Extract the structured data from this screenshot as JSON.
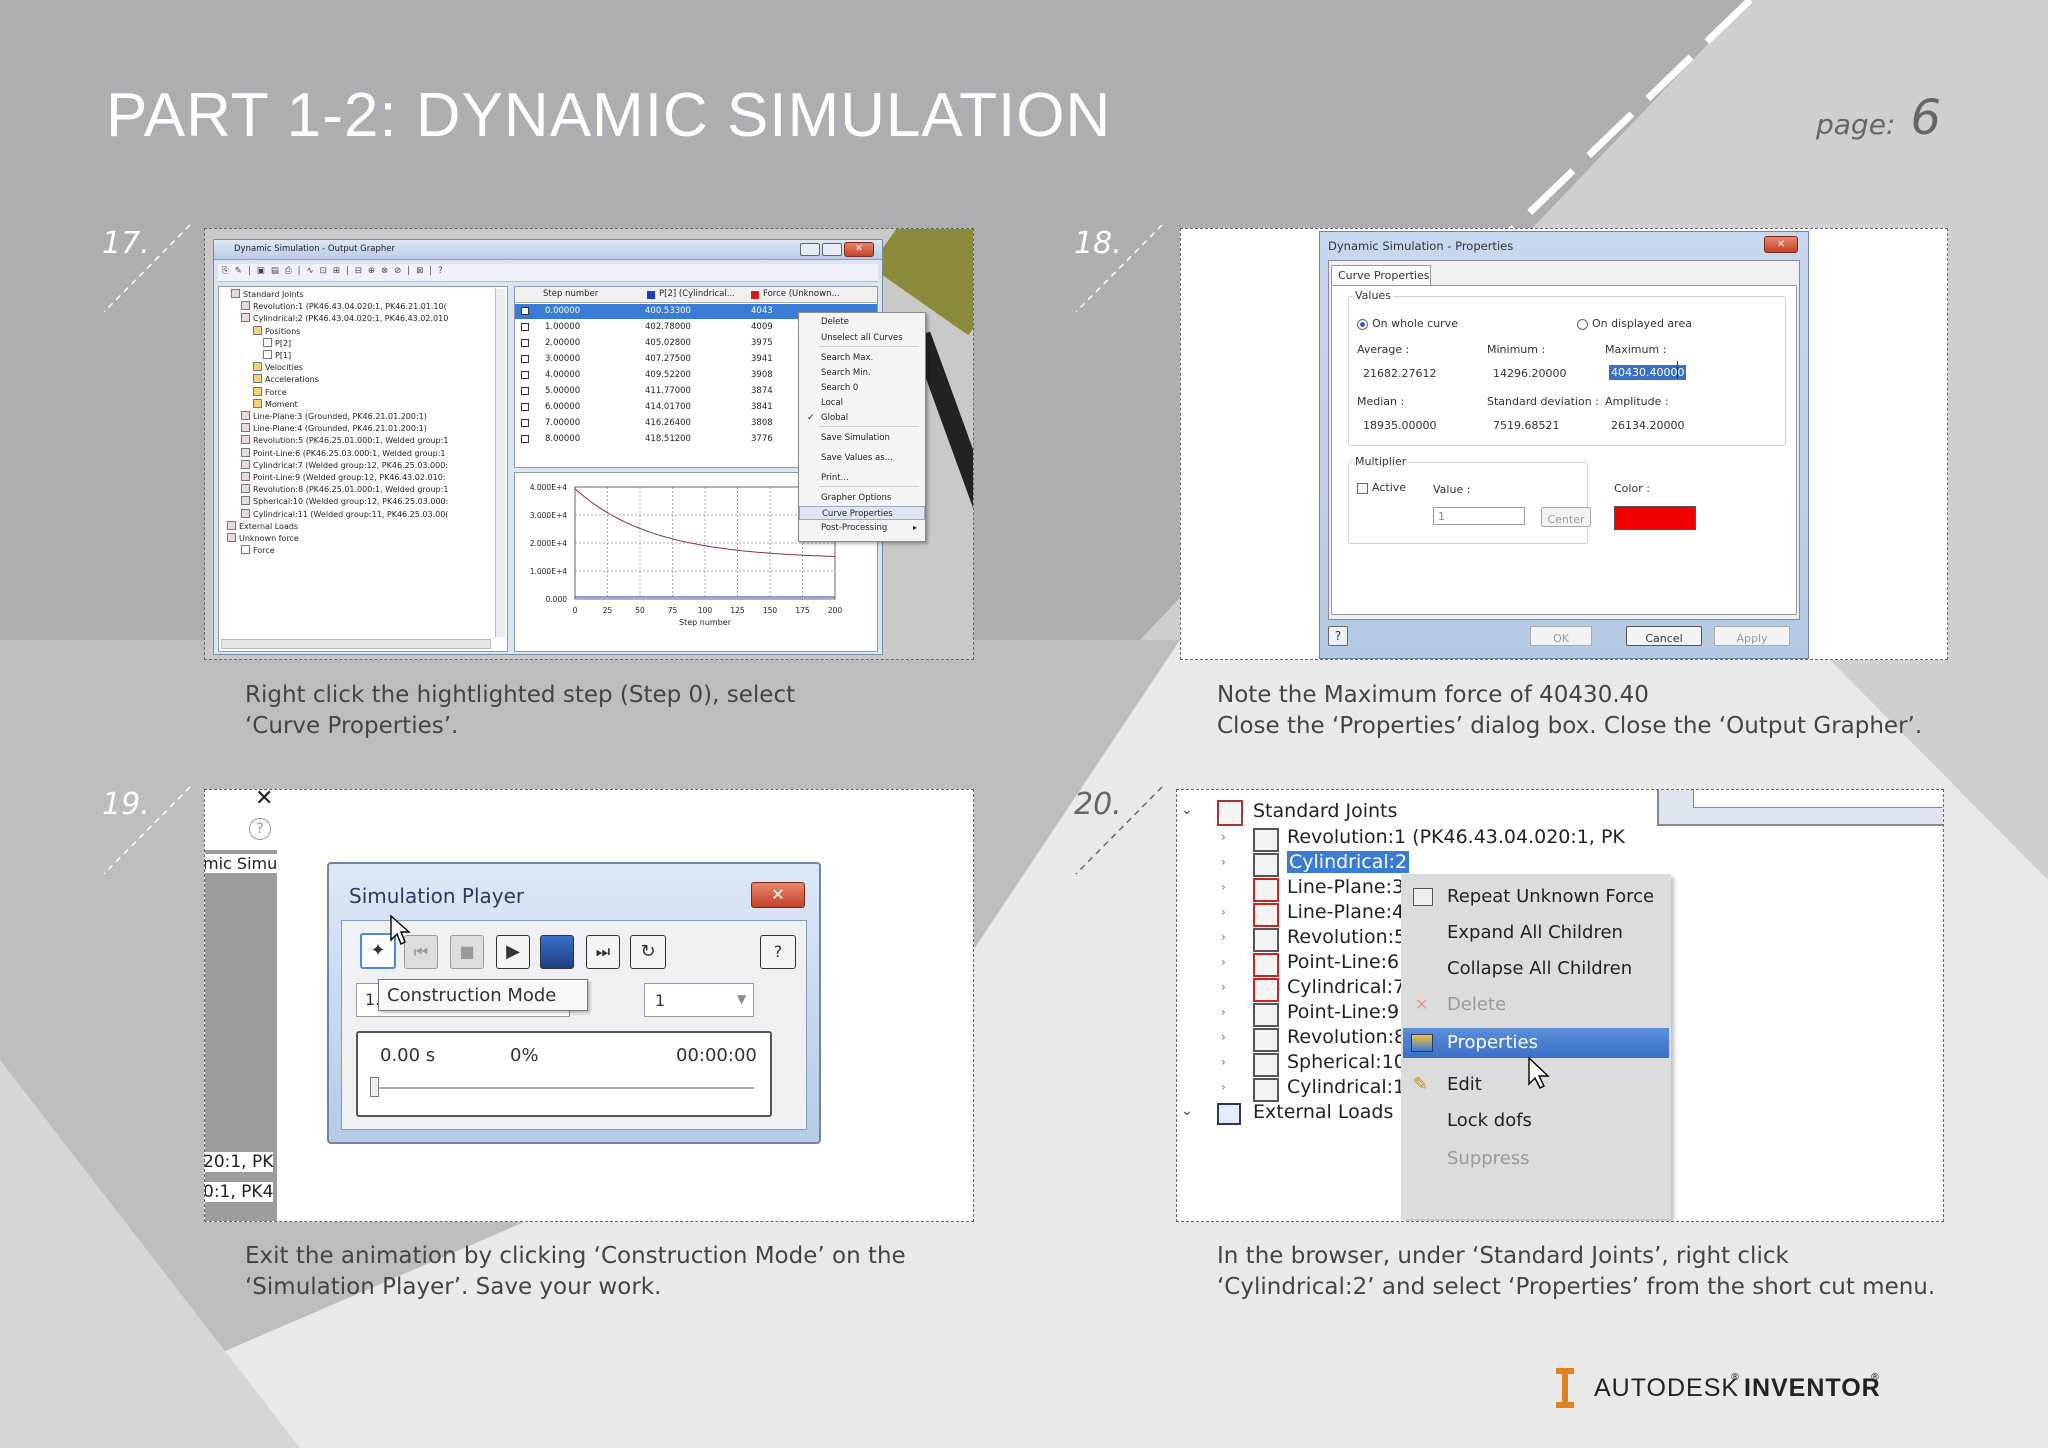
{
  "header": {
    "title": "PART 1-2: DYNAMIC SIMULATION",
    "page_label": "page:",
    "page_number": "6"
  },
  "colors": {
    "title": "#ffffff",
    "bg_gray": "#aeaeb2",
    "accent_red": "#ee0000",
    "highlight": "#3a7bd5",
    "logo_orange": "#e0801e"
  },
  "steps": [
    {
      "number": "17.",
      "caption": [
        "Right click the hightlighted step (Step 0), select",
        "‘Curve Properties’."
      ]
    },
    {
      "number": "18.",
      "caption": [
        "Note the Maximum force of 40430.40",
        "Close the ‘Properties’ dialog box. Close the ‘Output Grapher’."
      ]
    },
    {
      "number": "19.",
      "caption": [
        "Exit the animation by clicking ‘Construction Mode’ on the",
        "‘Simulation Player’. Save your work."
      ]
    },
    {
      "number": "20.",
      "caption": [
        "In the browser, under ‘Standard Joints’, right click",
        "‘Cylindrical:2’ and select ‘Properties’ from the short cut menu."
      ]
    }
  ],
  "grapher": {
    "title": "Dynamic Simulation - Output Grapher",
    "tree": [
      "Standard Joints",
      "Revolution:1 (PK46.43.04.020:1, PK46.21.01.10(",
      "Cylindrical:2 (PK46.43.04.020:1, PK46.43.02.010",
      "Positions",
      "P[2]",
      "P[1]",
      "Velocities",
      "Accelerations",
      "Force",
      "Moment",
      "Line-Plane:3 (Grounded, PK46.21.01.200:1)",
      "Line-Plane:4 (Grounded, PK46.21.01.200:1)",
      "Revolution:5 (PK46.25.01.000:1, Welded group:1",
      "Point-Line:6 (PK46.25.03.000:1, Welded group:1",
      "Cylindrical:7 (Welded group:12, PK46.25.03.000:",
      "Point-Line:9 (Welded group:12, PK46.43.02.010:",
      "Revolution:8 (PK46.25.01.000:1, Welded group:1",
      "Spherical:10 (Welded group:12, PK46.25.03.000:",
      "Cylindrical:11 (Welded group:11, PK46.25.03.00(",
      "External Loads",
      "Unknown force",
      "Force"
    ],
    "columns": [
      "Step number",
      "P[2] (Cylindrical...",
      "Force (Unknown..."
    ],
    "rows": [
      [
        "0.00000",
        "400.53300",
        "4043"
      ],
      [
        "1.00000",
        "402.78000",
        "4009"
      ],
      [
        "2.00000",
        "405.02800",
        "3975"
      ],
      [
        "3.00000",
        "407.27500",
        "3941"
      ],
      [
        "4.00000",
        "409.52200",
        "3908"
      ],
      [
        "5.00000",
        "411.77000",
        "3874"
      ],
      [
        "6.00000",
        "414.01700",
        "3841"
      ],
      [
        "7.00000",
        "416.26400",
        "3808"
      ],
      [
        "8.00000",
        "418.51200",
        "3776"
      ]
    ],
    "context_menu": [
      "Delete",
      "Unselect all Curves",
      "Search Max.",
      "Search Min.",
      "Search 0",
      "Local",
      "Global",
      "Save Simulation",
      "Save Values as...",
      "Print...",
      "Grapher Options",
      "Curve Properties",
      "Post-Processing"
    ],
    "y_ticks": [
      "4.000E+4",
      "3.000E+4",
      "2.000E+4",
      "1.000E+4",
      "0.000"
    ],
    "x_ticks": [
      "0",
      "25",
      "50",
      "75",
      "100",
      "125",
      "150",
      "175",
      "200"
    ],
    "x_label": "Step number"
  },
  "properties": {
    "title": "Dynamic Simulation - Properties",
    "tab": "Curve Properties",
    "values_group": "Values",
    "radio_whole": "On whole curve",
    "radio_displayed": "On displayed area",
    "average_label": "Average :",
    "average": "21682.27612",
    "minimum_label": "Minimum :",
    "minimum": "14296.20000",
    "maximum_label": "Maximum :",
    "maximum": "40430.40000",
    "median_label": "Median :",
    "median": "18935.00000",
    "stddev_label": "Standard deviation :",
    "stddev": "7519.68521",
    "amplitude_label": "Amplitude :",
    "amplitude": "26134.20000",
    "multiplier_group": "Multiplier",
    "active_label": "Active",
    "value_label": "Value :",
    "value": "1",
    "center_btn": "Center",
    "color_label": "Color :",
    "ok_btn": "OK",
    "cancel_btn": "Cancel",
    "apply_btn": "Apply"
  },
  "player": {
    "title": "Simulation Player",
    "tooltip": "Construction Mode",
    "field_left": "1.",
    "field_right": "1",
    "time": "0.00 s",
    "percent": "0%",
    "clock": "00:00:00",
    "bg_text": [
      "mic Simu",
      "20:1, PK",
      "0:1, PK4"
    ]
  },
  "browser": {
    "root": "Standard Joints",
    "items": [
      "Revolution:1 (PK46.43.04.020:1, PK",
      "Cylindrical:2",
      "Line-Plane:3",
      "Line-Plane:4",
      "Revolution:5",
      "Point-Line:6",
      "Cylindrical:7",
      "Point-Line:9",
      "Revolution:8",
      "Spherical:10",
      "Cylindrical:11"
    ],
    "external": "External Loads",
    "menu": [
      "Repeat Unknown Force",
      "Expand All Children",
      "Collapse All Children",
      "Delete",
      "Properties",
      "Edit",
      "Lock dofs",
      "Suppress"
    ]
  },
  "logo": {
    "brand": "AUTODESK",
    "product": "INVENTOR",
    "mark": "®"
  }
}
